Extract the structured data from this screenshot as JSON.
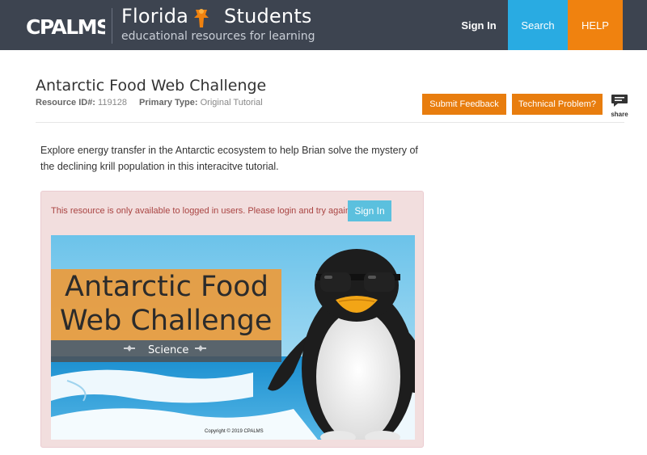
{
  "header": {
    "logo_text": "CPALMS",
    "brand_title": "Florida",
    "brand_title2": "Students",
    "brand_subtitle": "educational resources for learning",
    "nav": {
      "signin": "Sign In",
      "search": "Search",
      "help": "HELP"
    },
    "colors": {
      "bar": "#3d4450",
      "search": "#29abe2",
      "help": "#f0820f"
    }
  },
  "resource": {
    "title": "Antarctic Food Web Challenge",
    "id_label": "Resource ID#:",
    "id_value": "119128",
    "type_label": "Primary Type:",
    "type_value": "Original Tutorial",
    "submit_feedback": "Submit Feedback",
    "technical_problem": "Technical Problem?",
    "share": "share",
    "description": "Explore energy transfer in the Antarctic ecosystem to help Brian solve the mystery of the declining krill population in this interacitve tutorial."
  },
  "alert": {
    "message": "This resource is only available to logged in users. Please login and try again.",
    "signin": "Sign In"
  },
  "thumbnail": {
    "title_line1": "Antarctic Food",
    "title_line2": "Web Challenge",
    "subject": "Science",
    "copyright": "Copyright © 2019 CPALMS"
  }
}
